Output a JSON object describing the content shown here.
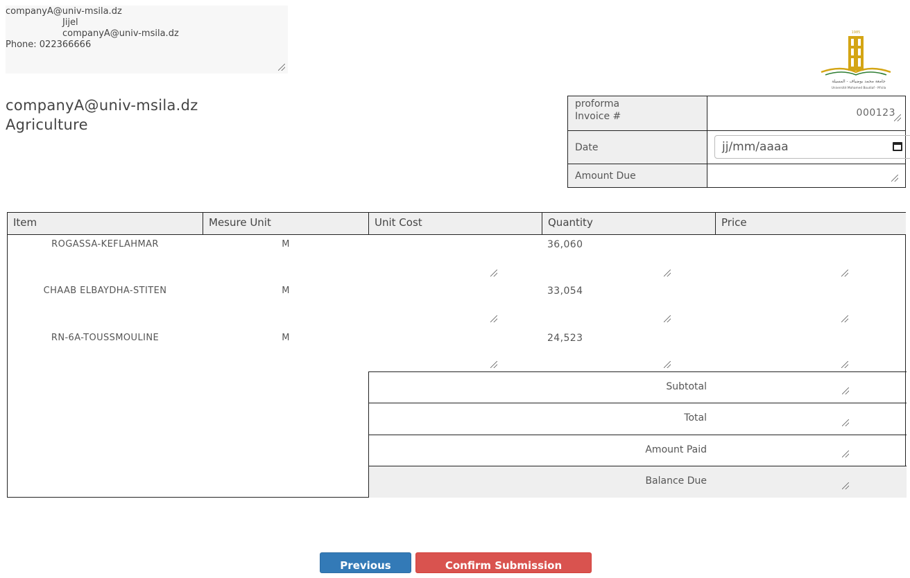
{
  "address": {
    "lines": [
      "companyA@univ-msila.dz",
      "Jijel",
      "companyA@univ-msila.dz",
      "Phone: 022366666"
    ]
  },
  "company": {
    "email": "companyA@univ-msila.dz",
    "sector": "Agriculture"
  },
  "logo": {
    "year": "1985",
    "arabic": "جامعة محمد بوضياف - المسيلة",
    "latin": "Université Mohamed Boudiaf - M'sila"
  },
  "meta": {
    "invoice_label": "proforma Invoice #",
    "invoice_value": "000123",
    "date_label": "Date",
    "date_placeholder": "jj/mm/aaaa",
    "amount_due_label": "Amount Due"
  },
  "table": {
    "headers": [
      "Item",
      "Mesure Unit",
      "Unit Cost",
      "Quantity",
      "Price"
    ],
    "rows": [
      {
        "item": "ROGASSA-KEFLAHMAR",
        "unit": "M",
        "quantity": "36,060"
      },
      {
        "item": "CHAAB ELBAYDHA-STITEN",
        "unit": "M",
        "quantity": "33,054"
      },
      {
        "item": "RN-6A-TOUSSMOULINE",
        "unit": "M",
        "quantity": "24,523"
      }
    ]
  },
  "totals": {
    "subtotal": "Subtotal",
    "total": "Total",
    "amount_paid": "Amount Paid",
    "balance_due": "Balance Due"
  },
  "buttons": {
    "previous": "Previous",
    "confirm": "Confirm Submission"
  },
  "colors": {
    "previous_bg": "#337ab7",
    "confirm_bg": "#d9534f",
    "header_bg": "#efefef"
  }
}
